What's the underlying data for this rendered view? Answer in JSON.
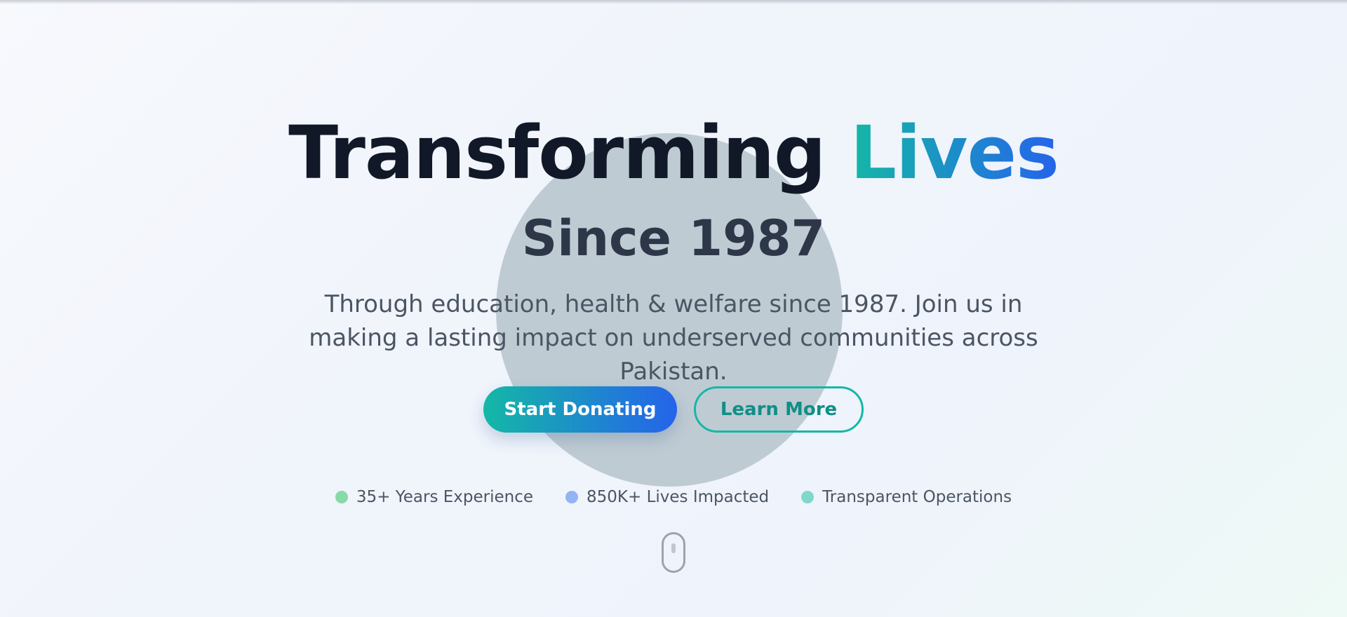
{
  "hero": {
    "headline_main": "Transforming",
    "headline_accent": "Lives",
    "subheadline": "Since 1987",
    "description": "Through education, health & welfare since 1987. Join us in making a lasting impact on underserved communities across Pakistan.",
    "primary_button_label": "Start Donating",
    "secondary_button_label": "Learn More",
    "stats": [
      {
        "label": "35+ Years Experience",
        "dot_color": "#86d9a8"
      },
      {
        "label": "850K+ Lives Impacted",
        "dot_color": "#93b4f3"
      },
      {
        "label": "Transparent Operations",
        "dot_color": "#7fd8cb"
      }
    ]
  },
  "colors": {
    "accent_gradient_start": "#14b8a6",
    "accent_gradient_end": "#2563eb",
    "headline": "#111827",
    "body_text": "#4b5563"
  },
  "icons": {
    "scroll_indicator": "mouse-scroll-icon"
  }
}
